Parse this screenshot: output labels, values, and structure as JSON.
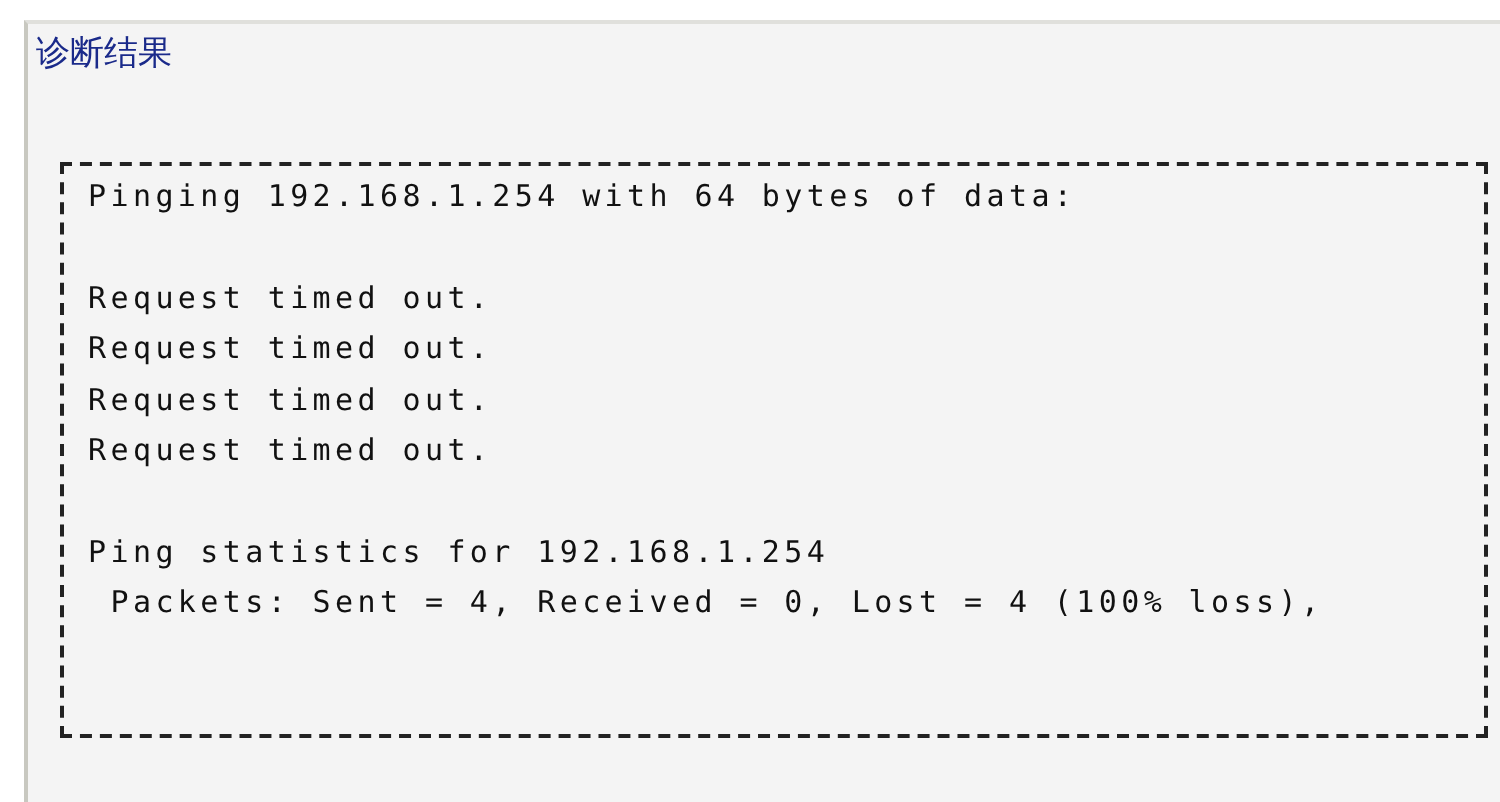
{
  "panel": {
    "title": "诊断结果",
    "output": [
      {
        "lines": [
          "Pinging 192.168.1.254 with 64 bytes of data:"
        ]
      },
      {
        "lines": [
          "Request timed out.",
          "Request timed out.",
          "Request timed out.",
          "Request timed out."
        ]
      },
      {
        "lines": [
          "Ping statistics for 192.168.1.254",
          " Packets: Sent = 4, Received = 0, Lost = 4 (100% loss),"
        ]
      }
    ]
  }
}
